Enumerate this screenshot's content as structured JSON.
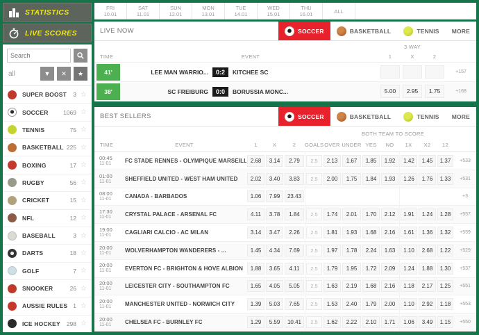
{
  "colors": {
    "frame_green": "#17734a",
    "accent_red": "#e8222d",
    "live_badge_green": "#4caf50",
    "brand_yellow": "#ece71f",
    "score_badge_black": "#1b1b1b"
  },
  "sidebar": {
    "statistics_label": "STATISTICS",
    "live_scores_label": "LIVE SCORES",
    "search_placeholder": "Search",
    "filter_value": "all",
    "sports": [
      {
        "name": "SUPER BOOST",
        "count": "3",
        "icon": "super-boost-icon"
      },
      {
        "name": "SOCCER",
        "count": "1069",
        "icon": "soccer-icon"
      },
      {
        "name": "TENNIS",
        "count": "75",
        "icon": "tennis-icon"
      },
      {
        "name": "BASKETBALL",
        "count": "225",
        "icon": "basketball-icon"
      },
      {
        "name": "BOXING",
        "count": "17",
        "icon": "boxing-icon"
      },
      {
        "name": "RUGBY",
        "count": "56",
        "icon": "rugby-icon"
      },
      {
        "name": "CRICKET",
        "count": "15",
        "icon": "cricket-icon"
      },
      {
        "name": "NFL",
        "count": "12",
        "icon": "nfl-icon"
      },
      {
        "name": "BASEBALL",
        "count": "3",
        "icon": "baseball-icon"
      },
      {
        "name": "DARTS",
        "count": "18",
        "icon": "darts-icon"
      },
      {
        "name": "GOLF",
        "count": "7",
        "icon": "golf-icon"
      },
      {
        "name": "SNOOKER",
        "count": "26",
        "icon": "snooker-icon"
      },
      {
        "name": "AUSSIE RULES",
        "count": "1",
        "icon": "aussie-rules-icon"
      },
      {
        "name": "ICE HOCKEY",
        "count": "298",
        "icon": "ice-hockey-icon"
      }
    ]
  },
  "datebar": {
    "tabs": [
      {
        "day": "FRI",
        "date": "10.01"
      },
      {
        "day": "SAT",
        "date": "11.01"
      },
      {
        "day": "SUN",
        "date": "12.01"
      },
      {
        "day": "MON",
        "date": "13.01"
      },
      {
        "day": "TUE",
        "date": "14.01"
      },
      {
        "day": "WED",
        "date": "15.01"
      },
      {
        "day": "THU",
        "date": "16.01"
      },
      {
        "day": "ALL",
        "date": ""
      }
    ]
  },
  "section_tabs": [
    {
      "label": "SOCCER",
      "icon": "soccer-ball-icon",
      "active": true
    },
    {
      "label": "BASKETBALL",
      "icon": "basketball-ball-icon",
      "active": false
    },
    {
      "label": "TENNIS",
      "icon": "tennis-ball-icon",
      "active": false
    },
    {
      "label": "MORE",
      "active": false
    }
  ],
  "live_now": {
    "title": "LIVE NOW",
    "time_label": "TIME",
    "event_label": "EVENT",
    "group_label": "3 WAY",
    "odds_labels": [
      "1",
      "X",
      "2"
    ],
    "rows": [
      {
        "time": "41'",
        "home": "LEE MAN WARRIO...",
        "score": "0:2",
        "away": "KITCHEE SC",
        "odds": [
          "",
          "",
          ""
        ],
        "more": "+157"
      },
      {
        "time": "38'",
        "home": "SC FREIBURG",
        "score": "0:0",
        "away": "BORUSSIA MONC...",
        "odds": [
          "5.00",
          "2.95",
          "1.75"
        ],
        "more": "+168"
      }
    ]
  },
  "best_sellers": {
    "title": "BEST SELLERS",
    "group_header": "BOTH TEAM TO SCORE",
    "columns": [
      "TIME",
      "EVENT",
      "1",
      "X",
      "2",
      "GOALS",
      "OVER",
      "UNDER",
      "YES",
      "NO",
      "1X",
      "X2",
      "12"
    ],
    "rows": [
      {
        "time": "00:45",
        "date": "11-01",
        "event": "FC STADE RENNES - OLYMPIQUE MARSEILLE",
        "cells": [
          "2.68",
          "3.14",
          "2.79",
          "2.5",
          "2.13",
          "1.67",
          "1.85",
          "1.92",
          "1.42",
          "1.45",
          "1.37"
        ],
        "more": "+533"
      },
      {
        "time": "01:00",
        "date": "11-01",
        "event": "SHEFFIELD UNITED - WEST HAM UNITED",
        "cells": [
          "2.02",
          "3.40",
          "3.83",
          "2.5",
          "2.00",
          "1.75",
          "1.84",
          "1.93",
          "1.26",
          "1.76",
          "1.33"
        ],
        "more": "+531"
      },
      {
        "time": "08:00",
        "date": "11-01",
        "event": "CANADA - BARBADOS",
        "cells": [
          "1.06",
          "7.99",
          "23.43",
          "",
          "",
          "",
          "",
          "",
          "",
          "",
          ""
        ],
        "more": "+3"
      },
      {
        "time": "17:30",
        "date": "11-01",
        "event": "CRYSTAL PALACE - ARSENAL FC",
        "cells": [
          "4.11",
          "3.78",
          "1.84",
          "2.5",
          "1.74",
          "2.01",
          "1.70",
          "2.12",
          "1.91",
          "1.24",
          "1.28"
        ],
        "more": "+557"
      },
      {
        "time": "19:00",
        "date": "11-01",
        "event": "CAGLIARI CALCIO - AC MILAN",
        "cells": [
          "3.14",
          "3.47",
          "2.26",
          "2.5",
          "1.81",
          "1.93",
          "1.68",
          "2.16",
          "1.61",
          "1.36",
          "1.32"
        ],
        "more": "+559"
      },
      {
        "time": "20:00",
        "date": "11-01",
        "event": "WOLVERHAMPTON WANDERERS - ...",
        "cells": [
          "1.45",
          "4.34",
          "7.69",
          "2.5",
          "1.97",
          "1.78",
          "2.24",
          "1.63",
          "1.10",
          "2.68",
          "1.22"
        ],
        "more": "+529"
      },
      {
        "time": "20:00",
        "date": "11-01",
        "event": "EVERTON FC - BRIGHTON & HOVE ALBION",
        "cells": [
          "1.88",
          "3.65",
          "4.11",
          "2.5",
          "1.79",
          "1.95",
          "1.72",
          "2.09",
          "1.24",
          "1.88",
          "1.30"
        ],
        "more": "+537"
      },
      {
        "time": "20:00",
        "date": "11-01",
        "event": "LEICESTER CITY - SOUTHAMPTON FC",
        "cells": [
          "1.65",
          "4.05",
          "5.05",
          "2.5",
          "1.63",
          "2.19",
          "1.68",
          "2.16",
          "1.18",
          "2.17",
          "1.25"
        ],
        "more": "+551"
      },
      {
        "time": "20:00",
        "date": "11-01",
        "event": "MANCHESTER UNITED - NORWICH CITY",
        "cells": [
          "1.39",
          "5.03",
          "7.65",
          "2.5",
          "1.53",
          "2.40",
          "1.79",
          "2.00",
          "1.10",
          "2.92",
          "1.18"
        ],
        "more": "+553"
      },
      {
        "time": "20:00",
        "date": "11-01",
        "event": "CHELSEA FC - BURNLEY FC",
        "cells": [
          "1.29",
          "5.59",
          "10.41",
          "2.5",
          "1.62",
          "2.22",
          "2.10",
          "1.71",
          "1.06",
          "3.49",
          "1.15"
        ],
        "more": "+550"
      }
    ]
  }
}
